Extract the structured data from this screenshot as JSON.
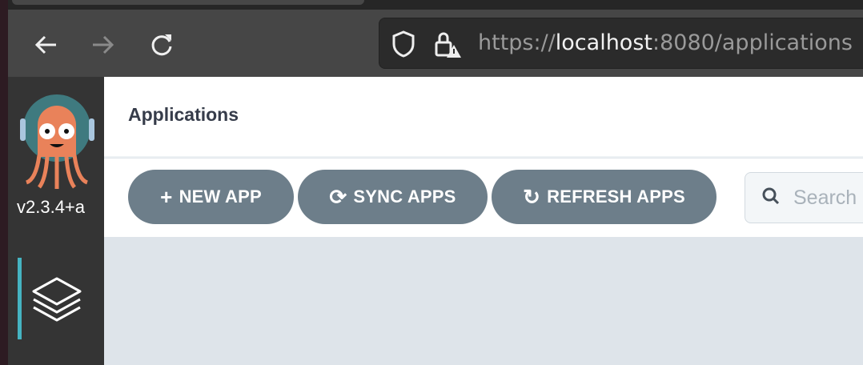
{
  "browser": {
    "url_scheme": "https://",
    "url_host": "localhost",
    "url_rest": ":8080/applications",
    "icons": [
      "back-arrow-icon",
      "forward-arrow-icon",
      "reload-icon",
      "shield-icon",
      "lock-warning-icon"
    ]
  },
  "sidebar": {
    "version": "v2.3.4+a",
    "items": [
      {
        "icon": "layers-icon",
        "active": true
      }
    ]
  },
  "header": {
    "title": "Applications"
  },
  "toolbar": {
    "new_app": "NEW APP",
    "sync_apps": "SYNC APPS",
    "refresh_apps": "REFRESH APPS"
  },
  "search": {
    "placeholder": "Search"
  },
  "colors": {
    "button": "#6d7e8a",
    "active_indicator": "#45b4c2",
    "logo_orange": "#e9825a",
    "logo_teal": "#3f7a7f"
  }
}
